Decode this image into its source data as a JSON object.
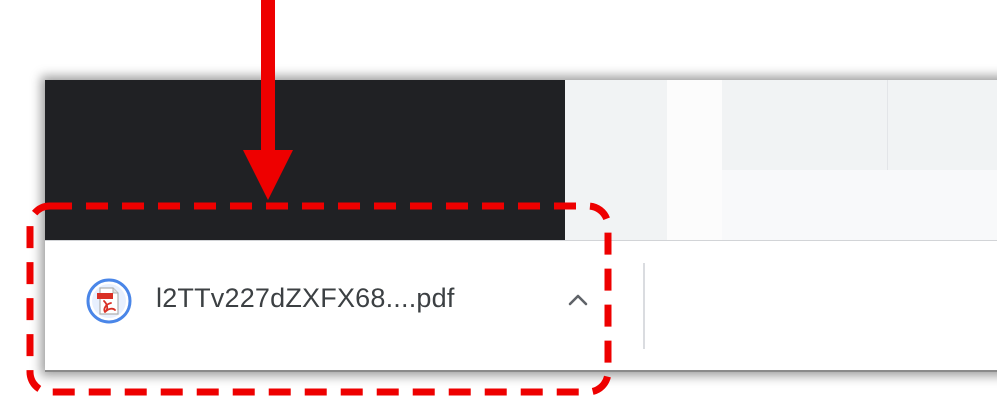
{
  "download_bar": {
    "item": {
      "file_name": "l2TTv227dZXFX68....pdf",
      "file_icon": "pdf-file-icon",
      "menu_icon": "chevron-up-icon"
    }
  },
  "annotation": {
    "arrow_icon": "arrow-down-icon",
    "highlight_style": "dashed-box",
    "color": "#ee0000"
  },
  "colors": {
    "dark_panel": "#202124",
    "light_panel": "#f8f9fa",
    "download_bar": "#ffffff",
    "file_name_text": "#3c4043",
    "pdf_red": "#d93025",
    "icon_ring": "#4a86e8"
  }
}
